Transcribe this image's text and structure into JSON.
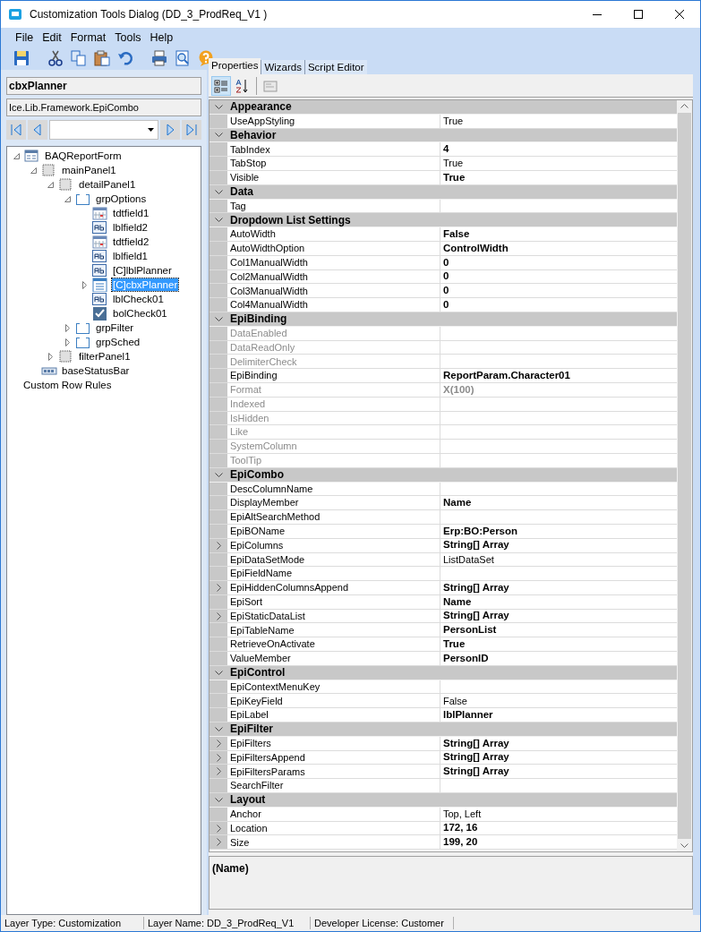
{
  "window": {
    "title": "Customization Tools Dialog  (DD_3_ProdReq_V1 )"
  },
  "menu": [
    "File",
    "Edit",
    "Format",
    "Tools",
    "Help"
  ],
  "toolbar": [
    {
      "kind": "save"
    },
    {
      "kind": "sep"
    },
    {
      "kind": "cut"
    },
    {
      "kind": "copy"
    },
    {
      "kind": "paste"
    },
    {
      "kind": "undo"
    },
    {
      "kind": "sep"
    },
    {
      "kind": "print"
    },
    {
      "kind": "preview"
    },
    {
      "kind": "help"
    }
  ],
  "control_name": "cbxPlanner",
  "control_type": "Ice.Lib.Framework.EpiCombo",
  "tree": [
    {
      "label": "BAQReportForm",
      "kind": "form",
      "expanded": true,
      "selected": false,
      "children": [
        {
          "label": "mainPanel1",
          "kind": "panel",
          "expanded": true,
          "selected": false,
          "children": [
            {
              "label": "detailPanel1",
              "kind": "panel",
              "expanded": true,
              "selected": false,
              "children": [
                {
                  "label": "grpOptions",
                  "kind": "group",
                  "expanded": true,
                  "selected": false,
                  "children": [
                    {
                      "label": "tdtfield1",
                      "kind": "date",
                      "selected": false
                    },
                    {
                      "label": "lblfield2",
                      "kind": "label",
                      "selected": false
                    },
                    {
                      "label": "tdtfield2",
                      "kind": "date",
                      "selected": false
                    },
                    {
                      "label": "lblfield1",
                      "kind": "label",
                      "selected": false
                    },
                    {
                      "label": "[C]lblPlanner",
                      "kind": "label",
                      "selected": false
                    },
                    {
                      "label": "[C]cbxPlanner",
                      "kind": "combo",
                      "expanded": false,
                      "selected": true
                    },
                    {
                      "label": "lblCheck01",
                      "kind": "label",
                      "selected": false
                    },
                    {
                      "label": "bolCheck01",
                      "kind": "check",
                      "selected": false
                    }
                  ]
                },
                {
                  "label": "grpFilter",
                  "kind": "group",
                  "expanded": false,
                  "selected": false
                },
                {
                  "label": "grpSched",
                  "kind": "group",
                  "expanded": false,
                  "selected": false
                }
              ]
            },
            {
              "label": "filterPanel1",
              "kind": "panel",
              "expanded": false,
              "selected": false
            }
          ]
        },
        {
          "label": "baseStatusBar",
          "kind": "status",
          "selected": false
        }
      ]
    },
    {
      "label": "Custom Row Rules",
      "kind": "text",
      "selected": false
    }
  ],
  "tabs": [
    {
      "label": "Properties",
      "selected": true
    },
    {
      "label": "Wizards",
      "selected": false
    },
    {
      "label": "Script Editor",
      "selected": false
    }
  ],
  "grid_tools": [
    {
      "kind": "categorized",
      "selected": true
    },
    {
      "kind": "alphabetical",
      "selected": false
    },
    {
      "kind": "pages",
      "selected": false
    }
  ],
  "categories": [
    {
      "name": "Appearance",
      "expanded": true,
      "rows": [
        {
          "name": "UseAppStyling",
          "value": "True",
          "bold": false
        }
      ]
    },
    {
      "name": "Behavior",
      "expanded": true,
      "rows": [
        {
          "name": "TabIndex",
          "value": "4",
          "bold": true
        },
        {
          "name": "TabStop",
          "value": "True",
          "bold": false
        },
        {
          "name": "Visible",
          "value": "True",
          "bold": true
        }
      ]
    },
    {
      "name": "Data",
      "expanded": true,
      "rows": [
        {
          "name": "Tag"
        }
      ]
    },
    {
      "name": "Dropdown List Settings",
      "expanded": true,
      "rows": [
        {
          "name": "AutoWidth",
          "value": "False",
          "bold": true
        },
        {
          "name": "AutoWidthOption",
          "value": "ControlWidth",
          "bold": true
        },
        {
          "name": "Col1ManualWidth",
          "value": "0",
          "bold": true
        },
        {
          "name": "Col2ManualWidth",
          "value": "0",
          "bold": true
        },
        {
          "name": "Col3ManualWidth",
          "value": "0",
          "bold": true
        },
        {
          "name": "Col4ManualWidth",
          "value": "0",
          "bold": true
        }
      ]
    },
    {
      "name": "EpiBinding",
      "expanded": true,
      "rows": [
        {
          "name": "DataEnabled",
          "disabled": true
        },
        {
          "name": "DataReadOnly",
          "disabled": true
        },
        {
          "name": "DelimiterCheck",
          "disabled": true
        },
        {
          "name": "EpiBinding",
          "value": "ReportParam.Character01",
          "bold": true,
          "disabled": false
        },
        {
          "name": "Format",
          "value": "X(100)",
          "disabled": true,
          "bold": true
        },
        {
          "name": "Indexed",
          "disabled": true
        },
        {
          "name": "IsHidden",
          "disabled": true
        },
        {
          "name": "Like",
          "disabled": true
        },
        {
          "name": "SystemColumn",
          "disabled": true
        },
        {
          "name": "ToolTip",
          "disabled": true
        }
      ]
    },
    {
      "name": "EpiCombo",
      "expanded": true,
      "rows": [
        {
          "name": "DescColumnName"
        },
        {
          "name": "DisplayMember",
          "value": "Name",
          "bold": true
        },
        {
          "name": "EpiAltSearchMethod"
        },
        {
          "name": "EpiBOName",
          "value": "Erp:BO:Person",
          "bold": true
        },
        {
          "name": "EpiColumns",
          "value": "String[] Array",
          "bold": true,
          "expandable": true
        },
        {
          "name": "EpiDataSetMode",
          "value": "ListDataSet",
          "bold": false
        },
        {
          "name": "EpiFieldName"
        },
        {
          "name": "EpiHiddenColumnsAppend",
          "value": "String[] Array",
          "bold": true,
          "expandable": true
        },
        {
          "name": "EpiSort",
          "value": "Name",
          "bold": true
        },
        {
          "name": "EpiStaticDataList",
          "value": "String[] Array",
          "bold": true,
          "expandable": true
        },
        {
          "name": "EpiTableName",
          "value": "PersonList",
          "bold": true
        },
        {
          "name": "RetrieveOnActivate",
          "value": "True",
          "bold": true
        },
        {
          "name": "ValueMember",
          "value": "PersonID",
          "bold": true
        }
      ]
    },
    {
      "name": "EpiControl",
      "expanded": true,
      "rows": [
        {
          "name": "EpiContextMenuKey"
        },
        {
          "name": "EpiKeyField",
          "value": "False",
          "bold": false
        },
        {
          "name": "EpiLabel",
          "value": "lblPlanner",
          "bold": true
        }
      ]
    },
    {
      "name": "EpiFilter",
      "expanded": true,
      "rows": [
        {
          "name": "EpiFilters",
          "value": "String[] Array",
          "bold": true,
          "expandable": true
        },
        {
          "name": "EpiFiltersAppend",
          "value": "String[] Array",
          "bold": true,
          "expandable": true
        },
        {
          "name": "EpiFiltersParams",
          "value": "String[] Array",
          "bold": true,
          "expandable": true
        },
        {
          "name": "SearchFilter"
        }
      ]
    },
    {
      "name": "Layout",
      "expanded": true,
      "rows": [
        {
          "name": "Anchor",
          "value": "Top, Left",
          "bold": false
        },
        {
          "name": "Location",
          "value": "172, 16",
          "bold": true,
          "expandable": true
        },
        {
          "name": "Size",
          "value": "199, 20",
          "bold": true,
          "expandable": true
        }
      ]
    }
  ],
  "description": {
    "title": "(Name)"
  },
  "status_bar": [
    "Layer Type:  Customization",
    "Layer Name:  DD_3_ProdReq_V1",
    "Developer License:  Customer"
  ]
}
